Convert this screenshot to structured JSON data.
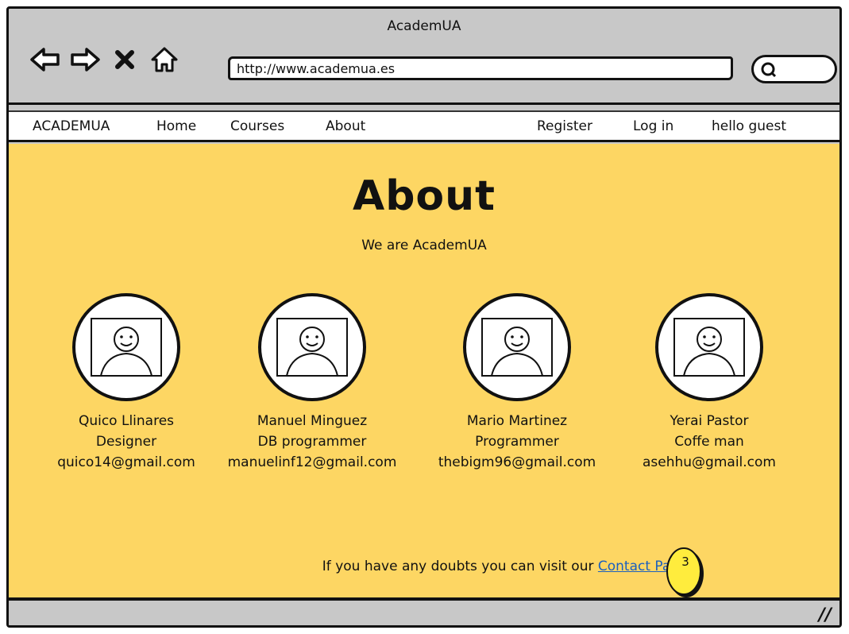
{
  "browser": {
    "title": "AcademUA",
    "url": "http://www.academua.es",
    "icons": [
      "back-arrow-icon",
      "forward-arrow-icon",
      "close-icon",
      "home-icon",
      "search-icon"
    ]
  },
  "nav": {
    "brand": "ACADEMUA",
    "home": "Home",
    "courses": "Courses",
    "about": "About",
    "register": "Register",
    "login": "Log in",
    "greeting": "hello guest"
  },
  "page": {
    "heading": "About",
    "subheading": "We are AcademUA",
    "background": "#fdd663"
  },
  "team": [
    {
      "name": "Quico Llinares",
      "role": "Designer",
      "email": "quico14@gmail.com"
    },
    {
      "name": "Manuel Minguez",
      "role": "DB programmer",
      "email": "manuelinf12@gmail.com"
    },
    {
      "name": "Mario Martinez",
      "role": "Programmer",
      "email": "thebigm96@gmail.com"
    },
    {
      "name": "Yerai Pastor",
      "role": "Coffe man",
      "email": "asehhu@gmail.com"
    }
  ],
  "footer": {
    "text": "If you have any doubts you can visit our",
    "link": "Contact Page.",
    "badge": "3"
  }
}
